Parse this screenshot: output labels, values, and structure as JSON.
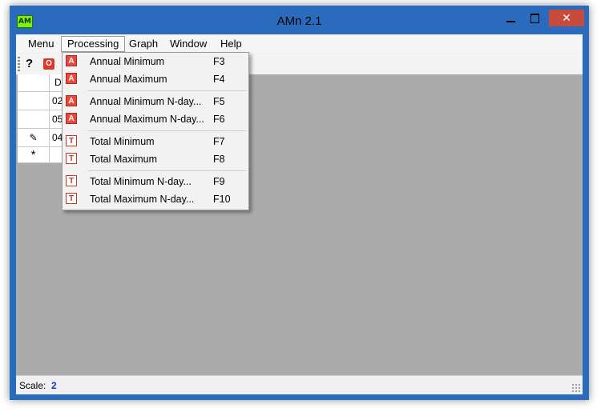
{
  "window": {
    "title": "AMn 2.1",
    "app_icon_text": "AM",
    "close_glyph": "✕"
  },
  "menubar": {
    "items": [
      {
        "label": "Menu"
      },
      {
        "label": "Processing"
      },
      {
        "label": "Graph"
      },
      {
        "label": "Window"
      },
      {
        "label": "Help"
      }
    ]
  },
  "toolbar": {
    "help_glyph": "?",
    "power_glyph": "O"
  },
  "grid": {
    "header": "D",
    "rows": [
      {
        "marker": "",
        "value": "02"
      },
      {
        "marker": "",
        "value": "05"
      },
      {
        "marker": "✎",
        "value": "04"
      },
      {
        "marker": "*",
        "value": ""
      }
    ]
  },
  "processing_menu": {
    "groups": [
      [
        {
          "icon": "A",
          "label": "Annual Minimum",
          "shortcut": "F3"
        },
        {
          "icon": "A",
          "label": "Annual Maximum",
          "shortcut": "F4"
        }
      ],
      [
        {
          "icon": "A",
          "label": "Annual Minimum N-day...",
          "shortcut": "F5"
        },
        {
          "icon": "A",
          "label": "Annual Maximum N-day...",
          "shortcut": "F6"
        }
      ],
      [
        {
          "icon": "T",
          "label": "Total Minimum",
          "shortcut": "F7"
        },
        {
          "icon": "T",
          "label": "Total Maximum",
          "shortcut": "F8"
        }
      ],
      [
        {
          "icon": "T",
          "label": "Total Minimum N-day...",
          "shortcut": "F9"
        },
        {
          "icon": "T",
          "label": "Total Maximum N-day...",
          "shortcut": "F10"
        }
      ]
    ]
  },
  "statusbar": {
    "scale_label": "Scale:",
    "scale_value": "2"
  }
}
